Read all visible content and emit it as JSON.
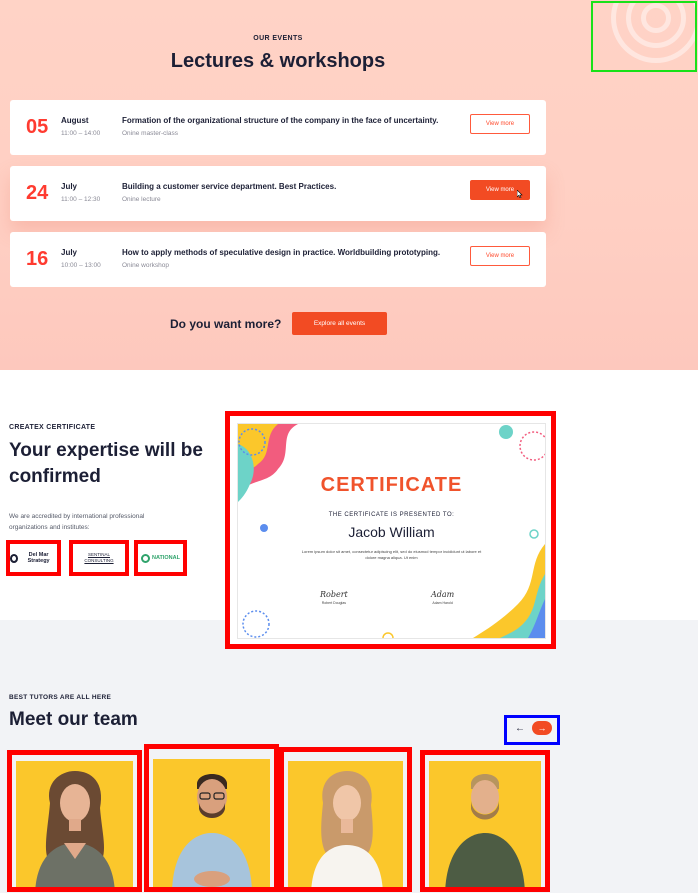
{
  "events_section": {
    "eyebrow": "OUR EVENTS",
    "title": "Lectures & workshops",
    "events": [
      {
        "day": "05",
        "month": "August",
        "time": "11:00 – 14:00",
        "title": "Formation of the organizational structure of the company in the face of uncertainty.",
        "type": "Onine master-class",
        "button": "View more"
      },
      {
        "day": "24",
        "month": "July",
        "time": "11:00 – 12:30",
        "title": "Building a customer service department. Best Practices.",
        "type": "Onine lecture",
        "button": "View more"
      },
      {
        "day": "16",
        "month": "July",
        "time": "10:00 – 13:00",
        "title": "How to apply methods of speculative design in practice. Worldbuilding prototyping.",
        "type": "Onine workshop",
        "button": "View more"
      }
    ],
    "more_text": "Do you want more?",
    "explore_button": "Explore all events"
  },
  "certificate_section": {
    "eyebrow": "CREATEX CERTIFICATE",
    "title": "Your expertise will be confirmed",
    "description": "We are accredited by international professional organizations and institutes:",
    "logos": [
      {
        "name": "Del Mar Strategy"
      },
      {
        "name": "SENTINAL CONSULTING"
      },
      {
        "name": "NATIONAL"
      }
    ],
    "certificate": {
      "heading": "CERTIFICATE",
      "presented": "THE CERTIFICATE IS PRESENTED TO:",
      "recipient": "Jacob William",
      "lorem": "Lorem ipsum dolor sit amet, consectetur adipiscing elit, sed do eiusmod tempor incididunt ut labore et dolore magna aliqua. Ut enim",
      "signatures": [
        {
          "script": "Robert",
          "name": "Robert Douglas"
        },
        {
          "script": "Adam",
          "name": "Adam Harold"
        }
      ]
    }
  },
  "team_section": {
    "eyebrow": "BEST TUTORS ARE ALL HERE",
    "title": "Meet our team",
    "nav": {
      "prev": "←",
      "next": "→"
    }
  },
  "colors": {
    "accent": "#f24b23",
    "day_red": "#ff3b30",
    "photo_bg": "#fbc72b",
    "annotation_red": "#ff0000",
    "annotation_blue": "#0000ff",
    "annotation_green": "#19e119"
  }
}
